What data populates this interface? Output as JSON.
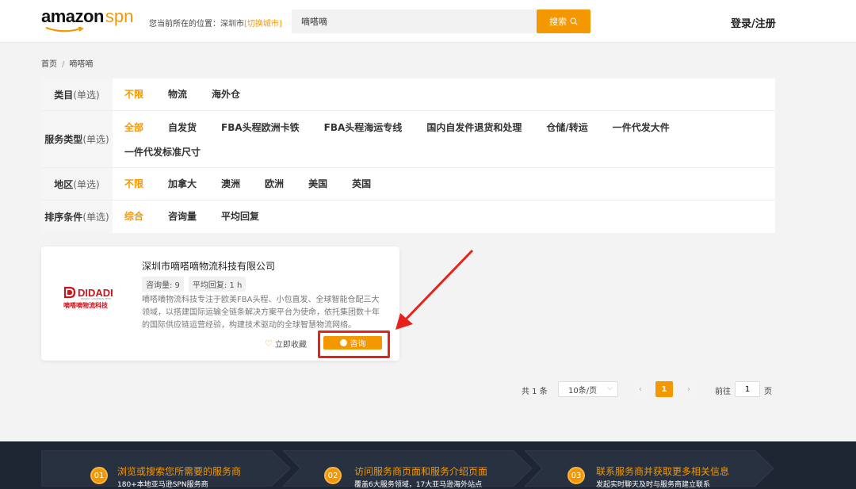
{
  "header": {
    "logo_main": "amazon",
    "logo_suffix": "spn",
    "location_prefix": "您当前所在的位置：深圳市",
    "location_switch": "[切换城市]",
    "search_value": "嘀嗒嘀",
    "search_button": "搜索",
    "login": "登录/注册"
  },
  "breadcrumb": {
    "home": "首页",
    "separator": "/",
    "current": "嘀嗒嘀"
  },
  "filters": [
    {
      "label": "类目",
      "hint": "(单选)",
      "options": [
        "不限",
        "物流",
        "海外仓"
      ],
      "active": 0
    },
    {
      "label": "服务类型",
      "hint": "(单选)",
      "options": [
        "全部",
        "自发货",
        "FBA头程欧洲卡铁",
        "FBA头程海运专线",
        "国内自发件退货和处理",
        "仓储/转运",
        "一件代发大件",
        "一件代发标准尺寸"
      ],
      "active": 0
    },
    {
      "label": "地区",
      "hint": "(单选)",
      "options": [
        "不限",
        "加拿大",
        "澳洲",
        "欧洲",
        "美国",
        "英国"
      ],
      "active": 0
    },
    {
      "label": "排序条件",
      "hint": "(单选)",
      "options": [
        "综合",
        "咨询量",
        "平均回复"
      ],
      "active": 0
    }
  ],
  "card": {
    "logo_text": "DIDADI",
    "logo_sub": "DIDADI · LOGISTICS TECH",
    "logo_cn": "嘀嗒嘀物流科技",
    "title": "深圳市嘀嗒嘀物流科技有限公司",
    "tag_consults": "咨询量:  9",
    "tag_reply": "平均回复:  1 h",
    "description": "嘀嗒嘀物流科技专注于欧美FBA头程、小包直发、全球智能仓配三大领域，以搭建国际运输全链条解决方案平台为使命，依托集团数十年的国际供应链运营经验，构建技术驱动的全球智慧物流网络。",
    "favorite": "立即收藏",
    "consult_button": "咨询"
  },
  "pagination": {
    "total": "共 1 条",
    "page_size": "10条/页",
    "prev": "‹",
    "current_page": "1",
    "next": "›",
    "goto_label": "前往",
    "goto_value": "1",
    "page_label": "页"
  },
  "footer": {
    "steps": [
      {
        "num": "01",
        "title": "浏览或搜索您所需要的服务商",
        "sub": "180+本地亚马逊SPN服务商"
      },
      {
        "num": "02",
        "title": "访问服务商页面和服务介绍页面",
        "sub": "覆盖6大服务领域，17大亚马逊海外站点"
      },
      {
        "num": "03",
        "title": "联系服务商并获取更多相关信息",
        "sub": "发起实时聊天及时与服务商建立联系"
      }
    ]
  },
  "colors": {
    "accent": "#f39800",
    "highlight": "#e5231b",
    "footer_bg": "#1f2633"
  }
}
